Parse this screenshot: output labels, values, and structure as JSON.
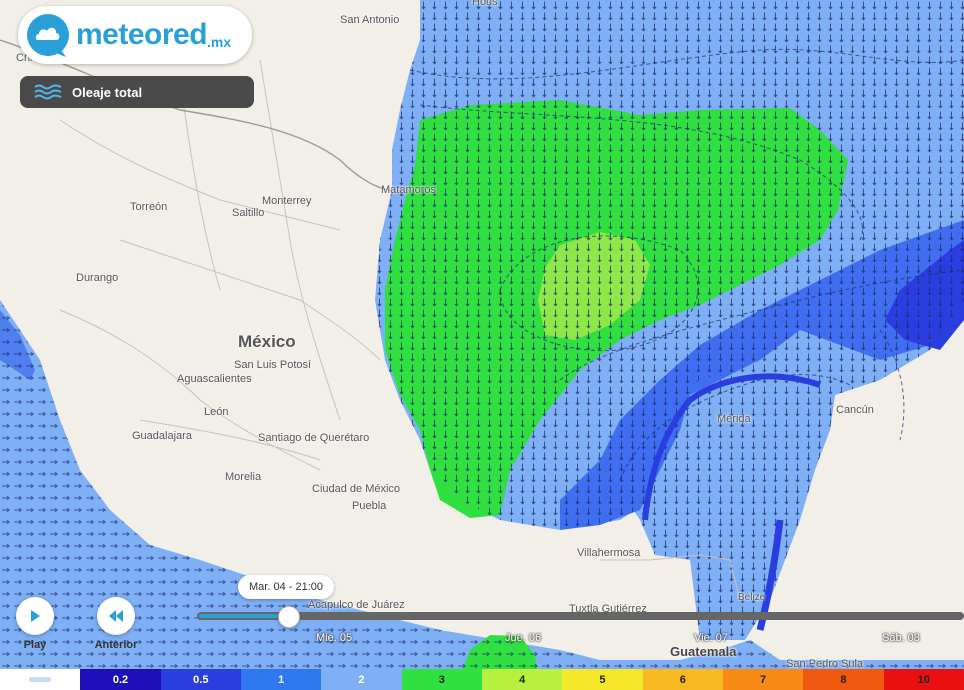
{
  "brand": {
    "name": "meteored",
    "tld": ".mx"
  },
  "layer": {
    "label": "Oleaje total",
    "icon": "waves-icon"
  },
  "cities": {
    "chi": "Chi",
    "san_antonio": "San Antonio",
    "houston": "Hous",
    "torreon": "Torreón",
    "monterrey": "Monterrey",
    "saltillo": "Saltillo",
    "matamoros": "Matamoros",
    "durango": "Durango",
    "mexico": "México",
    "san_luis": "San Luis Potosí",
    "aguascalientes": "Aguascalientes",
    "leon": "León",
    "guadalajara": "Guadalajara",
    "queretaro": "Santiago de Querétaro",
    "morelia": "Morelia",
    "cdmx": "Ciudad de México",
    "puebla": "Puebla",
    "merida": "Mérida",
    "cancun": "Cancún",
    "villahermosa": "Villahermosa",
    "acapulco": "Acapulco de Juárez",
    "tuxtla": "Tuxtla Gutiérrez",
    "belize": "Belize",
    "guatemala": "Guatemala",
    "san_pedro_sula": "San Pedro Sula"
  },
  "controls": {
    "play": "Play",
    "previous": "Anterior"
  },
  "timeline": {
    "current": "Mar. 04 - 21:00",
    "progress": 0.12,
    "days": [
      "Mié. 05",
      "Jue. 06",
      "Vie. 07",
      "Sáb. 08"
    ]
  },
  "legend": [
    {
      "label": "",
      "color": "#ffffff",
      "text": "#333333"
    },
    {
      "label": "0.2",
      "color": "#1f0fb8",
      "text": "#ffffff"
    },
    {
      "label": "0.5",
      "color": "#2a3ee0",
      "text": "#ffffff"
    },
    {
      "label": "1",
      "color": "#2f78f0",
      "text": "#ffffff"
    },
    {
      "label": "2",
      "color": "#7fb0f5",
      "text": "#ffffff"
    },
    {
      "label": "3",
      "color": "#2fe040",
      "text": "#222222"
    },
    {
      "label": "4",
      "color": "#b8f040",
      "text": "#222222"
    },
    {
      "label": "5",
      "color": "#f5e82a",
      "text": "#222222"
    },
    {
      "label": "6",
      "color": "#f8b820",
      "text": "#222222"
    },
    {
      "label": "7",
      "color": "#f88a18",
      "text": "#222222"
    },
    {
      "label": "8",
      "color": "#f05a10",
      "text": "#222222"
    },
    {
      "label": "10",
      "color": "#e81010",
      "text": "#222222"
    }
  ],
  "colors": {
    "accent": "#2a9fd8",
    "sea_base": "#7fb0f5",
    "sea_deep": "#3868f0",
    "wave_high": "#2fe040"
  }
}
